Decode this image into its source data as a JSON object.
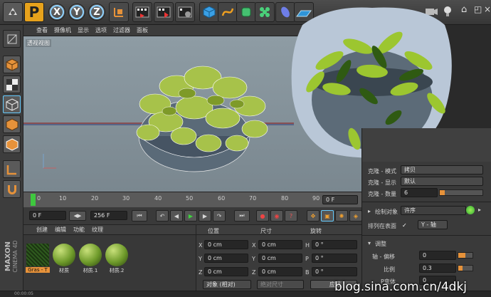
{
  "toolbar": {
    "axis_x": "X",
    "axis_y": "Y",
    "axis_z": "Z",
    "logo": "P",
    "icons": [
      "undo-icon",
      "live-select-icon",
      "move-icon",
      "scale-icon",
      "rotate-icon",
      "render-region-icon",
      "render-view-icon",
      "render-settings-icon",
      "cube-icon",
      "spline-icon",
      "nurbs-icon",
      "cloner-icon",
      "deformer-icon",
      "floor-icon",
      "light-icon",
      "camera-icon"
    ]
  },
  "viewport_menu": [
    "查看",
    "摄像机",
    "显示",
    "选项",
    "过滤器",
    "面板"
  ],
  "viewport": {
    "label": "透视视图"
  },
  "timeline": {
    "ticks": [
      "0",
      "10",
      "20",
      "30",
      "40",
      "50",
      "60",
      "70",
      "80",
      "90"
    ],
    "end_field": "0 F"
  },
  "transport": {
    "start_field": "0 F",
    "end_field": "256 F"
  },
  "material_manager": {
    "menu": [
      "创建",
      "编辑",
      "功能",
      "纹理"
    ],
    "materials": [
      "Gras - T",
      "材质",
      "材质.1",
      "材质.2"
    ]
  },
  "coordinates": {
    "headers": [
      "位置",
      "尺寸",
      "旋转"
    ],
    "rows": [
      {
        "axis": "X",
        "pos": "0 cm",
        "size_axis": "X",
        "size": "0 cm",
        "rot_axis": "H",
        "rot": "0 °"
      },
      {
        "axis": "Y",
        "pos": "0 cm",
        "size_axis": "Y",
        "size": "0 cm",
        "rot_axis": "P",
        "rot": "0 °"
      },
      {
        "axis": "Z",
        "pos": "0 cm",
        "size_axis": "Z",
        "size": "0 cm",
        "rot_axis": "B",
        "rot": "0 °"
      }
    ],
    "mode_select": "对象 (相对)",
    "size_select": "绝对尺寸",
    "apply_button": "应用"
  },
  "attributes": {
    "clone_mode_label": "克隆 - 模式",
    "clone_mode_value": "拷贝",
    "clone_display_label": "克隆 - 显示",
    "clone_display_value": "默认",
    "clone_count_label": "克隆 - 数量",
    "clone_count_value": "6",
    "draw_object_label": "绘制对象",
    "draw_object_value": "许序",
    "surface_label": "排列在表面",
    "surface_checked": "✓",
    "surface_axis": "Y - 轴",
    "adjust_header": "调整",
    "axis_offset_label": "轴 - 偏移",
    "axis_offset_value": "0",
    "scale_label": "比例",
    "scale_value": "0.3",
    "variation_label": "P变体",
    "variation_value": "0"
  },
  "brand": {
    "line1": "MAXON",
    "line2": "CINEMA 4D"
  },
  "watermark": "blog.sina.com.cn/4dkj",
  "status": "00:00:05"
}
